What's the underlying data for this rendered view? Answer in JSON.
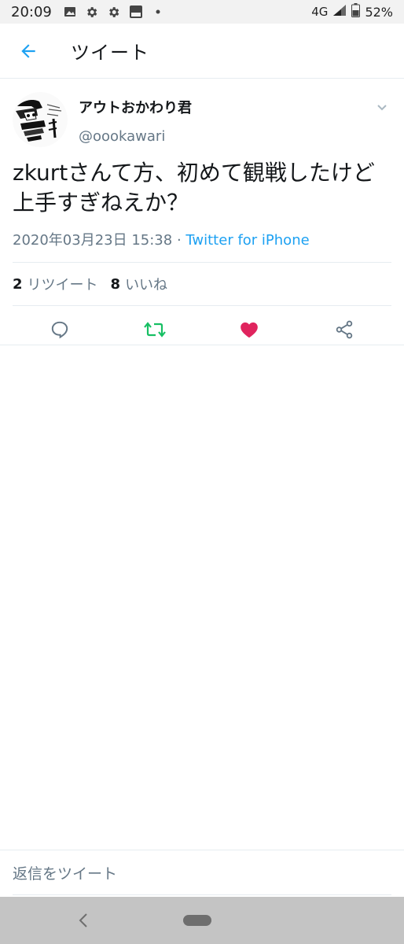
{
  "status_bar": {
    "time": "20:09",
    "network": "4G",
    "battery": "52%",
    "icons": [
      "photo-icon",
      "gear-icon",
      "gear-icon",
      "au-pay-icon",
      "dot-icon"
    ]
  },
  "header": {
    "title": "ツイート",
    "back_icon": "arrow-left-icon"
  },
  "tweet": {
    "display_name": "アウトおかわり君",
    "handle": "@oookawari",
    "text": "zkurtさんて方、初めて観戦したけど上手すぎねえか？",
    "timestamp": "2020年03月23日 15:38",
    "separator": " · ",
    "source": "Twitter for iPhone",
    "retweets_count": "2",
    "retweets_label": "リツイート",
    "likes_count": "8",
    "likes_label": "いいね"
  },
  "actions": {
    "reply_icon": "reply-icon",
    "retweet_icon": "retweet-icon",
    "like_icon": "heart-icon",
    "share_icon": "share-icon"
  },
  "reply_bar": {
    "placeholder": "返信をツイート"
  },
  "colors": {
    "accent": "#1da1f2",
    "retweet": "#17bf63",
    "like": "#e0245e",
    "secondary_text": "#657786"
  }
}
